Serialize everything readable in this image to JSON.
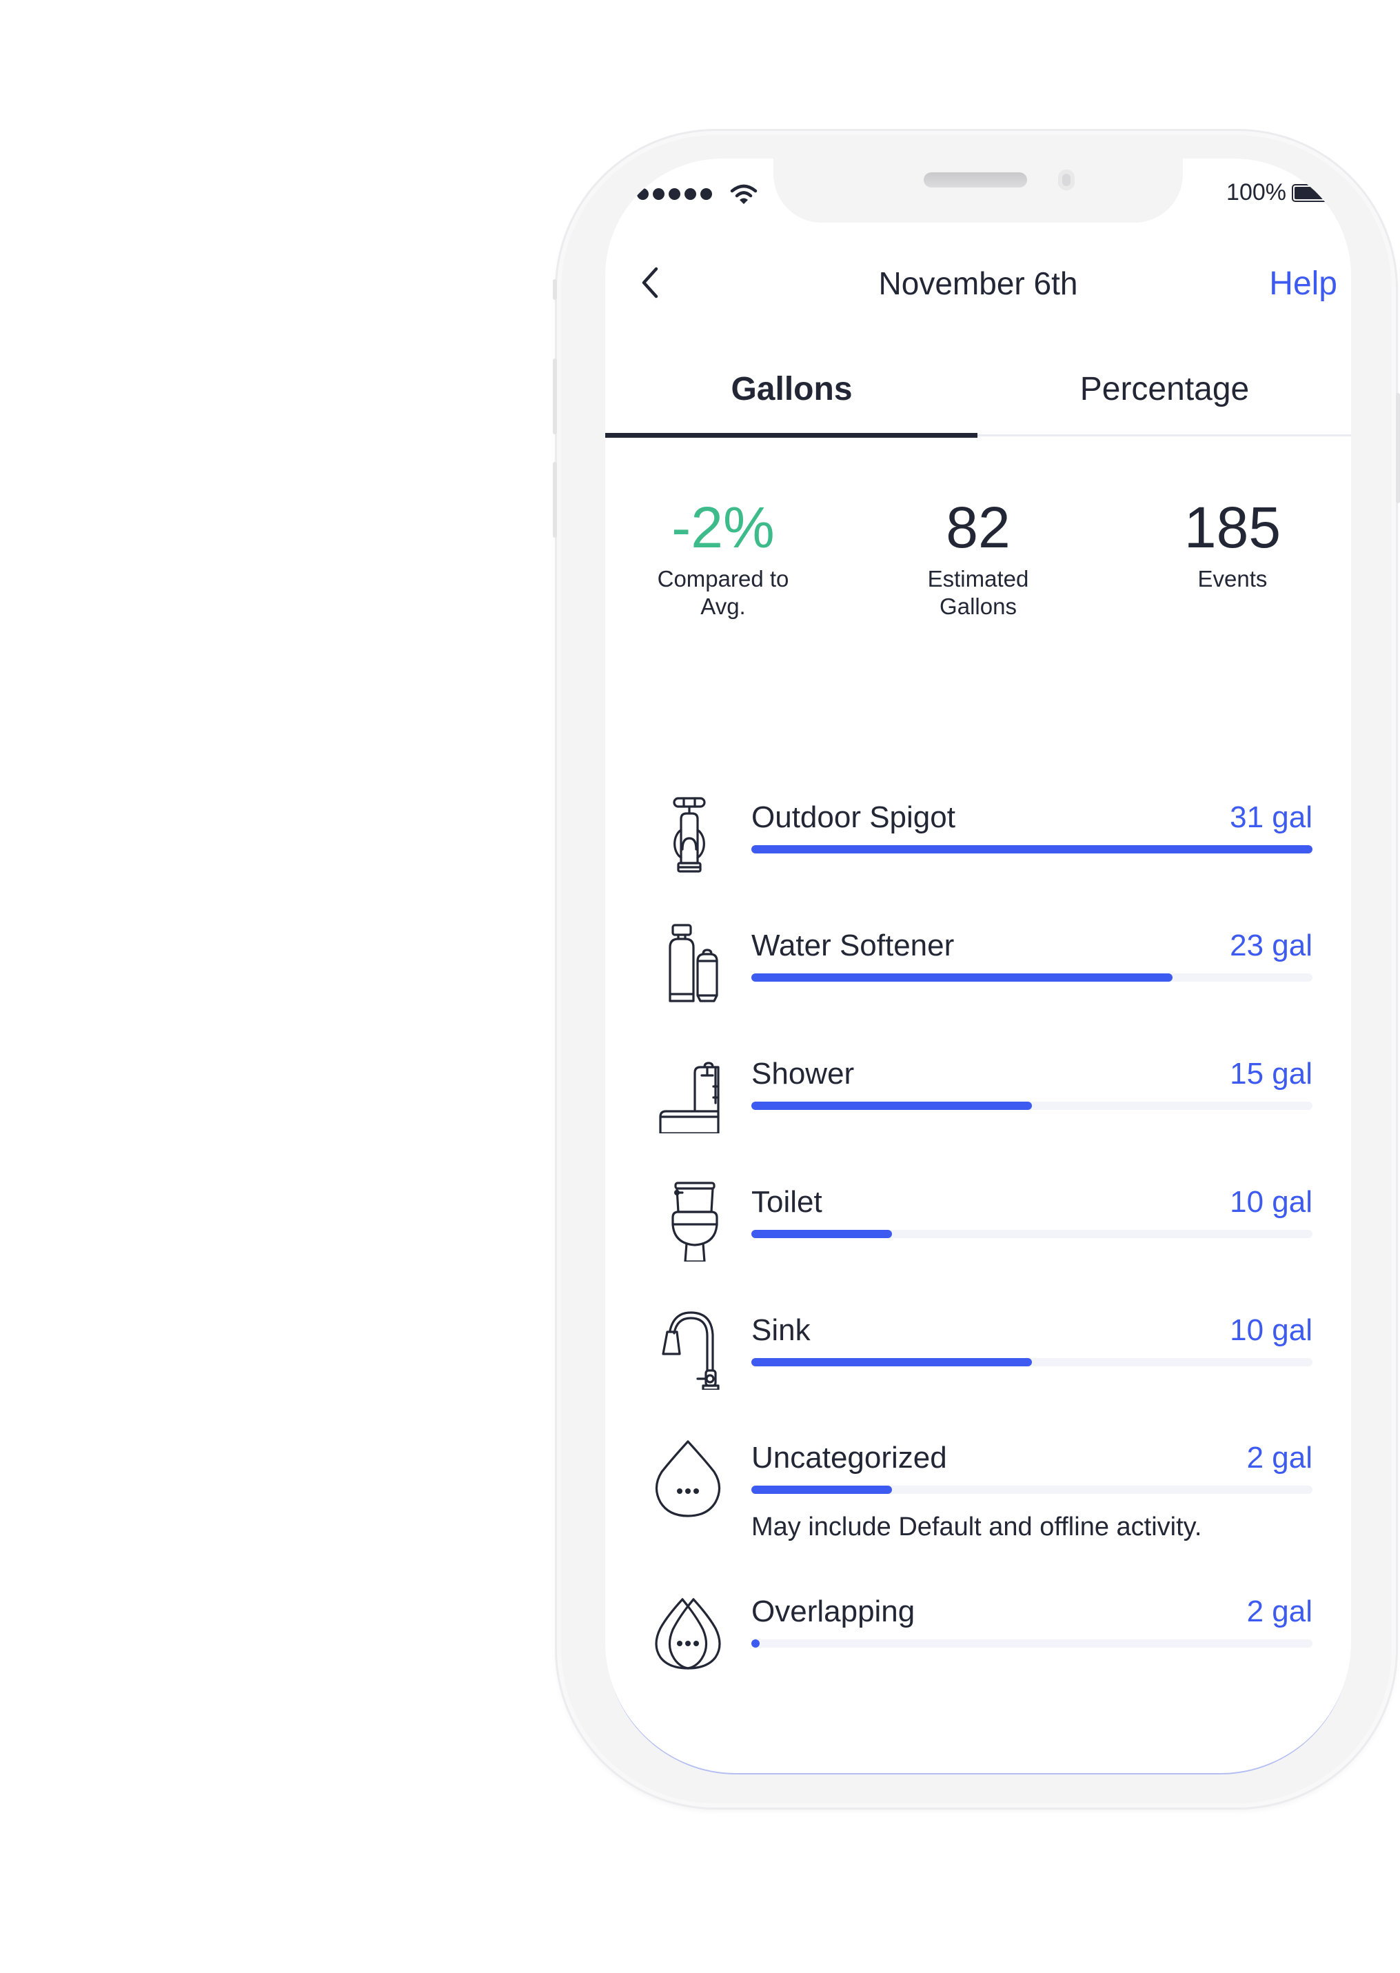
{
  "status_bar": {
    "signal_bars": 5,
    "battery_text": "100%",
    "battery_level": 1.0
  },
  "nav": {
    "back_icon": "chevron-left-icon",
    "title": "November 6th",
    "help_label": "Help"
  },
  "tabs": [
    {
      "label": "Gallons",
      "active": true
    },
    {
      "label": "Percentage",
      "active": false
    }
  ],
  "stats": [
    {
      "value": "-2%",
      "label": "Compared to\nAvg.",
      "color": "#3dbb8a"
    },
    {
      "value": "82",
      "label": "Estimated\nGallons"
    },
    {
      "value": "185",
      "label": "Events"
    }
  ],
  "colors": {
    "accent": "#3d5af1",
    "positive": "#3dbb8a",
    "text": "#232735",
    "track": "#f3f4fa"
  },
  "fixtures": [
    {
      "name": "Outdoor Spigot",
      "value": "31 gal",
      "fill": 1.0,
      "icon": "spigot-icon"
    },
    {
      "name": "Water Softener",
      "value": "23 gal",
      "fill": 0.75,
      "icon": "water-softener-icon"
    },
    {
      "name": "Shower",
      "value": "15 gal",
      "fill": 0.5,
      "icon": "shower-icon"
    },
    {
      "name": "Toilet",
      "value": "10 gal",
      "fill": 0.25,
      "icon": "toilet-icon"
    },
    {
      "name": "Sink",
      "value": "10 gal",
      "fill": 0.5,
      "icon": "sink-faucet-icon"
    },
    {
      "name": "Uncategorized",
      "value": "2 gal",
      "fill": 0.25,
      "icon": "water-drop-dots-icon",
      "note": "May include Default and offline activity."
    },
    {
      "name": "Overlapping",
      "value": "2 gal",
      "fill": 0.0,
      "icon": "overlapping-drops-icon"
    }
  ]
}
